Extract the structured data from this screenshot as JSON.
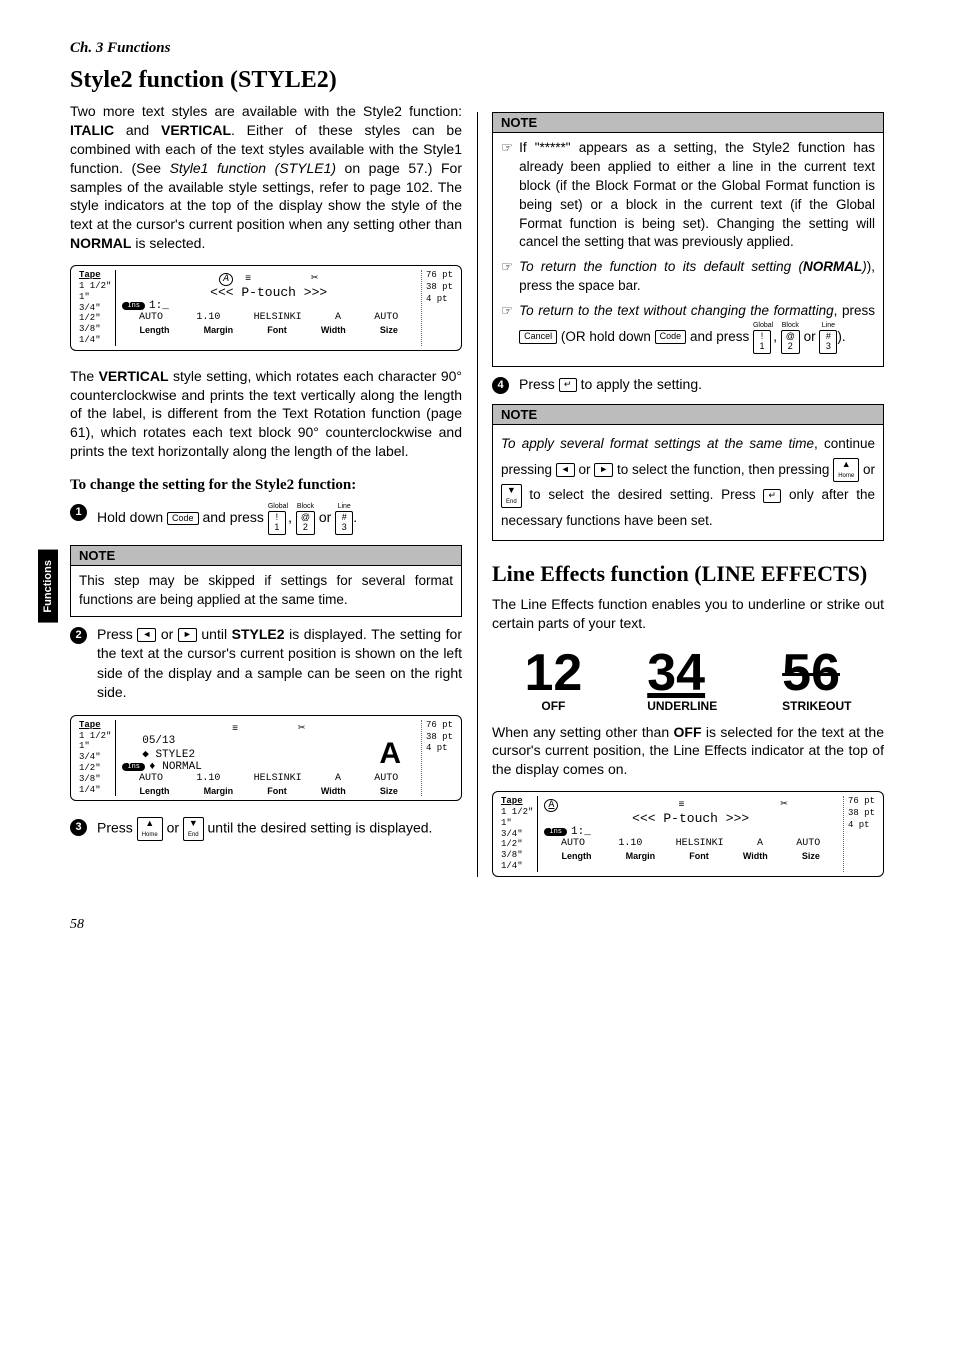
{
  "chapter": "Ch. 3 Functions",
  "side_tab": "Functions",
  "page_number": "58",
  "left": {
    "h1": "Style2 function (STYLE2)",
    "para1_a": "Two more text styles are available with the Style2 function: ",
    "para1_b": "ITALIC",
    "para1_c": " and ",
    "para1_d": "VERTICAL",
    "para1_e": ". Either of these styles can be combined with each of the text styles available with the Style1 function. (See ",
    "para1_f": "Style1 function (STYLE1)",
    "para1_g": " on page 57.) For samples of the available style settings, refer to page 102. The style indicators at the top of the display show the style of the text at the cursor's current position when any setting other than ",
    "para1_h": "NORMAL",
    "para1_i": " is selected.",
    "para2_a": "The ",
    "para2_b": "VERTICAL",
    "para2_c": " style setting, which rotates each character 90° counterclockwise and prints the text vertically along the length of the label, is different from the Text Rotation function (page 61), which rotates each text block 90° counterclockwise and prints the text horizontally along the length of the label.",
    "subhead": "To change the setting for the Style2 function:",
    "step1_a": "Hold down ",
    "step1_b": " and press ",
    "step1_c": " or ",
    "key_code": "Code",
    "key1_sup": "Global",
    "key1_top": "!",
    "key1_bot": "1",
    "key2_sup": "Block",
    "key2_top": "@",
    "key2_bot": "2",
    "key3_sup": "Line",
    "key3_top": "#",
    "key3_bot": "3",
    "note1_title": "NOTE",
    "note1_body": "This step may be skipped if settings for several format functions are being applied at the same time.",
    "step2_a": "Press ",
    "step2_b": " or ",
    "step2_c": " until ",
    "step2_d": "STYLE2",
    "step2_e": " is displayed. The setting for the text at the cursor's current position is shown on the left side of the display and a sample can be seen on the right side.",
    "step3_a": "Press ",
    "step3_b": " or ",
    "step3_c": " until the desired setting is displayed.",
    "key_left": "◄",
    "key_right": "►",
    "key_home": "Home",
    "key_end": "End",
    "key_up": "▲",
    "key_down": "▼",
    "lcd1": {
      "tape": "Tape",
      "sizes": [
        "1 1/2\"",
        "1\"",
        "3/4\"",
        "1/2\"",
        "3/8\"",
        "1/4\""
      ],
      "ins": "Ins",
      "A_indicator": "A",
      "text": "<<< P-touch >>>",
      "row_line": "1:_",
      "cols_mono": [
        "AUTO",
        "1.10",
        "HELSINKI",
        "A",
        "AUTO"
      ],
      "cols_bold": [
        "Length",
        "Margin",
        "Font",
        "Width",
        "Size"
      ],
      "pts": [
        "76 pt",
        "38 pt",
        "4 pt"
      ]
    },
    "lcd2": {
      "tape": "Tape",
      "sizes": [
        "1 1/2\"",
        "1\"",
        "3/4\"",
        "1/2\"",
        "3/8\"",
        "1/4\""
      ],
      "ins": "Ins",
      "line1": "05/13",
      "line2": "◆ STYLE2",
      "line3": "♦ NORMAL",
      "sample": "A",
      "cols_mono": [
        "AUTO",
        "1.10",
        "HELSINKI",
        "A",
        "AUTO"
      ],
      "cols_bold": [
        "Length",
        "Margin",
        "Font",
        "Width",
        "Size"
      ],
      "pts": [
        "76 pt",
        "38 pt",
        "4 pt"
      ]
    }
  },
  "right": {
    "note2_title": "NOTE",
    "note2_b1": "If \"*****\" appears as a setting, the Style2 function has already been applied to either a line in the current text block (if the Block Format or the Global Format function is being set) or a block in the current text (if the Global Format function is being set). Changing the setting will cancel the setting that was previously applied.",
    "note2_b2_a": "To return the function to its default setting (",
    "note2_b2_b": "NORMAL",
    "note2_b2_c": "), press the space bar.",
    "note2_b3_a": "To return to the text without changing the formatting",
    "note2_b3_b": ", press ",
    "note2_b3_c": " (OR hold down ",
    "note2_b3_d": " and press ",
    "note2_b3_e": " or ",
    "note2_b3_f": ").",
    "key_cancel": "Cancel",
    "step4_a": "Press ",
    "step4_b": " to apply the setting.",
    "key_enter": "↵",
    "note3_title": "NOTE",
    "note3_a": "To apply several format settings at the same time",
    "note3_b": ", continue pressing ",
    "note3_c": " or ",
    "note3_d": " to select the function, then pressing ",
    "note3_e": " or ",
    "note3_f": " to select the desired setting. Press ",
    "note3_g": " only after the necessary functions have been set.",
    "h2": "Line Effects function (LINE EFFECTS)",
    "para3": "The Line Effects function enables you to underline or strike out certain parts of your text.",
    "demo": {
      "off_num": "12",
      "off_label": "OFF",
      "und_num": "34",
      "und_label": "UNDERLINE",
      "str_num": "56",
      "str_label": "STRIKEOUT"
    },
    "para4_a": "When any setting other than ",
    "para4_b": "OFF",
    "para4_c": " is selected for the text at the cursor's current position, the Line Effects indicator at the top of the display comes on.",
    "lcd3": {
      "tape": "Tape",
      "sizes": [
        "1 1/2\"",
        "1\"",
        "3/4\"",
        "1/2\"",
        "3/8\"",
        "1/4\""
      ],
      "ins": "Ins",
      "A_indicator": "A",
      "text": "<<< P-touch >>>",
      "row_line": "1:_",
      "cols_mono": [
        "AUTO",
        "1.10",
        "HELSINKI",
        "A",
        "AUTO"
      ],
      "cols_bold": [
        "Length",
        "Margin",
        "Font",
        "Width",
        "Size"
      ],
      "pts": [
        "76 pt",
        "38 pt",
        "4 pt"
      ]
    }
  }
}
